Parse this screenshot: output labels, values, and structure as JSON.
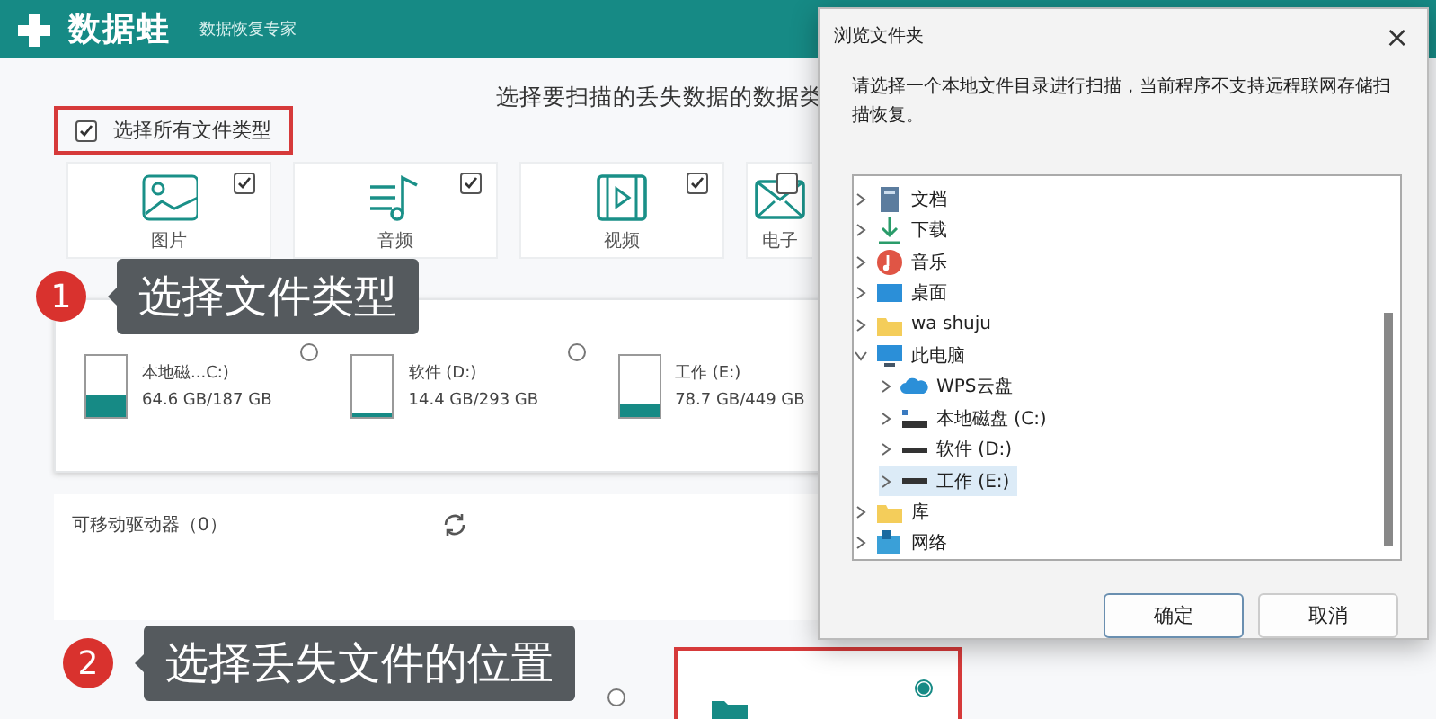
{
  "app": {
    "logo": "数据蛙",
    "tagline": "数据恢复专家"
  },
  "heading": "选择要扫描的丢失数据的数据类",
  "select_all": {
    "label": "选择所有文件类型",
    "checked": true
  },
  "file_types": [
    {
      "kind": "image",
      "label": "图片",
      "checked": true
    },
    {
      "kind": "audio",
      "label": "音频",
      "checked": true
    },
    {
      "kind": "video",
      "label": "视频",
      "checked": true
    },
    {
      "kind": "mail",
      "label": "电子",
      "checked": false
    }
  ],
  "drives": [
    {
      "name": "本地磁...C:)",
      "usage": "64.6 GB/187 GB",
      "level": 0.35,
      "selected": false
    },
    {
      "name": "软件 (D:)",
      "usage": "14.4 GB/293 GB",
      "level": 0.04,
      "selected": false
    },
    {
      "name": "工作 (E:)",
      "usage": "78.7 GB/449 GB",
      "level": 0.18
    }
  ],
  "removable": {
    "title": "可移动驱动器（0）"
  },
  "locations": [
    {
      "selected": false
    },
    {
      "selected": true
    }
  ],
  "callouts": [
    {
      "number": "1",
      "text": "选择文件类型"
    },
    {
      "number": "2",
      "text": "选择丢失文件的位置"
    }
  ],
  "dialog": {
    "title": "浏览文件夹",
    "close": "×",
    "message": "请选择一个本地文件目录进行扫描，当前程序不支持远程联网存储扫描恢复。",
    "tree": [
      {
        "kind": "document",
        "label": "文档",
        "expanded": false,
        "selected": false
      },
      {
        "kind": "download",
        "label": "下载",
        "expanded": false,
        "selected": false
      },
      {
        "kind": "music",
        "label": "音乐",
        "expanded": false,
        "selected": false
      },
      {
        "kind": "desktop",
        "label": "桌面",
        "expanded": false,
        "selected": false
      },
      {
        "kind": "folder",
        "label": "wa shuju",
        "expanded": false,
        "selected": false
      },
      {
        "kind": "pc",
        "label": "此电脑",
        "expanded": true,
        "selected": false,
        "children": [
          {
            "kind": "cloud",
            "label": "WPS云盘",
            "expanded": false,
            "selected": false
          },
          {
            "kind": "system-drive",
            "label": "本地磁盘 (C:)",
            "expanded": false,
            "selected": false
          },
          {
            "kind": "drive",
            "label": "软件 (D:)",
            "expanded": false,
            "selected": false
          },
          {
            "kind": "drive",
            "label": "工作 (E:)",
            "expanded": false,
            "selected": true
          }
        ]
      },
      {
        "kind": "library",
        "label": "库",
        "expanded": false,
        "selected": false
      },
      {
        "kind": "network",
        "label": "网络",
        "expanded": false,
        "selected": false
      }
    ],
    "buttons": [
      {
        "label": "确定",
        "kind": "primary"
      },
      {
        "label": "取消",
        "kind": "secondary"
      }
    ]
  }
}
